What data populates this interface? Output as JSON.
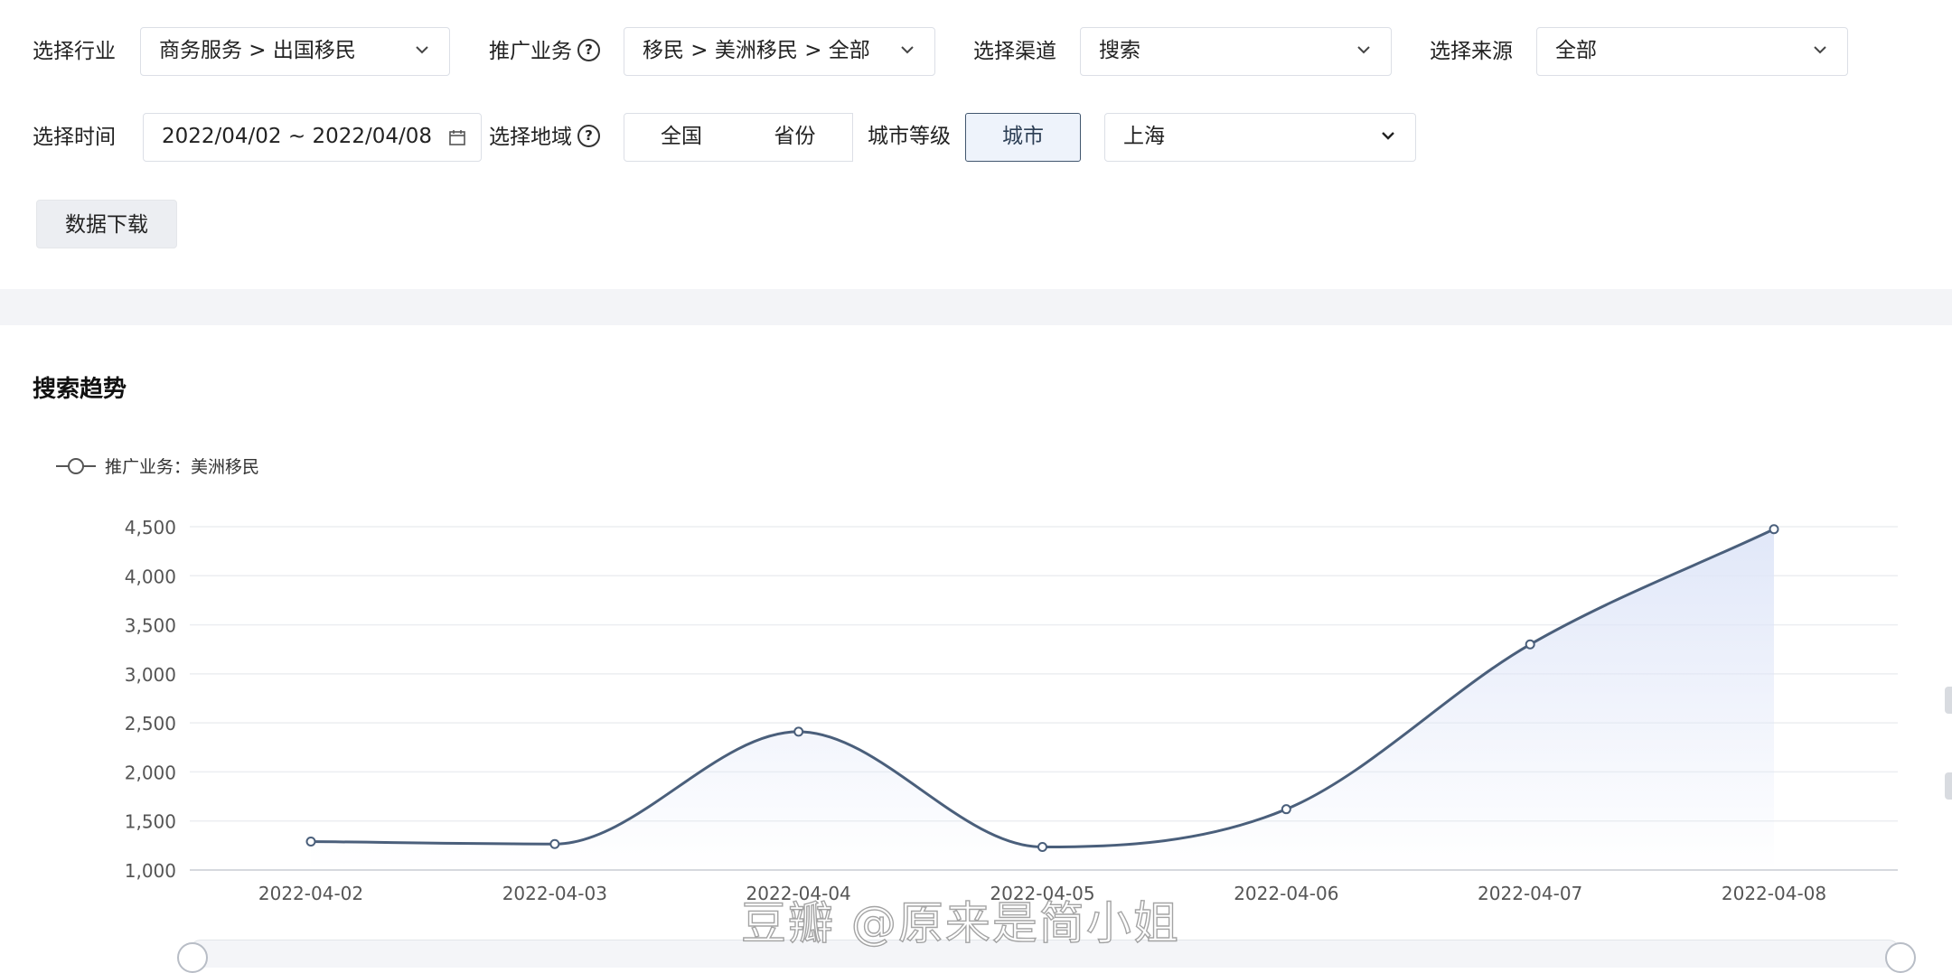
{
  "filters": {
    "industry": {
      "label": "选择行业",
      "value": "商务服务 > 出国移民"
    },
    "business": {
      "label": "推广业务",
      "value": "移民 > 美洲移民 > 全部"
    },
    "channel": {
      "label": "选择渠道",
      "value": "搜索"
    },
    "source": {
      "label": "选择来源",
      "value": "全部"
    },
    "time": {
      "label": "选择时间",
      "value": "2022/04/02 ~ 2022/04/08"
    },
    "region": {
      "label": "选择地域",
      "options": [
        "全国",
        "省份",
        "城市等级",
        "城市"
      ],
      "active": "城市",
      "city": "上海"
    },
    "help_icon": "?",
    "download_label": "数据下载"
  },
  "panel": {
    "title": "搜索趋势",
    "legend_label": "推广业务：美洲移民"
  },
  "watermark": "豆瓣 @原来是简小姐",
  "colors": {
    "line": "#4a5f7b",
    "area": "#dfe6f8",
    "active_border": "#41566e"
  },
  "chart_data": {
    "type": "area",
    "title": "搜索趋势",
    "series": [
      {
        "name": "推广业务：美洲移民",
        "values": [
          1290,
          1265,
          2410,
          1235,
          1620,
          3300,
          4475
        ]
      }
    ],
    "categories": [
      "2022-04-02",
      "2022-04-03",
      "2022-04-04",
      "2022-04-05",
      "2022-04-06",
      "2022-04-07",
      "2022-04-08"
    ],
    "yticks": [
      "1,000",
      "1,500",
      "2,000",
      "2,500",
      "3,000",
      "3,500",
      "4,000",
      "4,500"
    ],
    "ylim": [
      1000,
      4500
    ],
    "grid": true,
    "smooth": true,
    "legend": "top-left"
  }
}
